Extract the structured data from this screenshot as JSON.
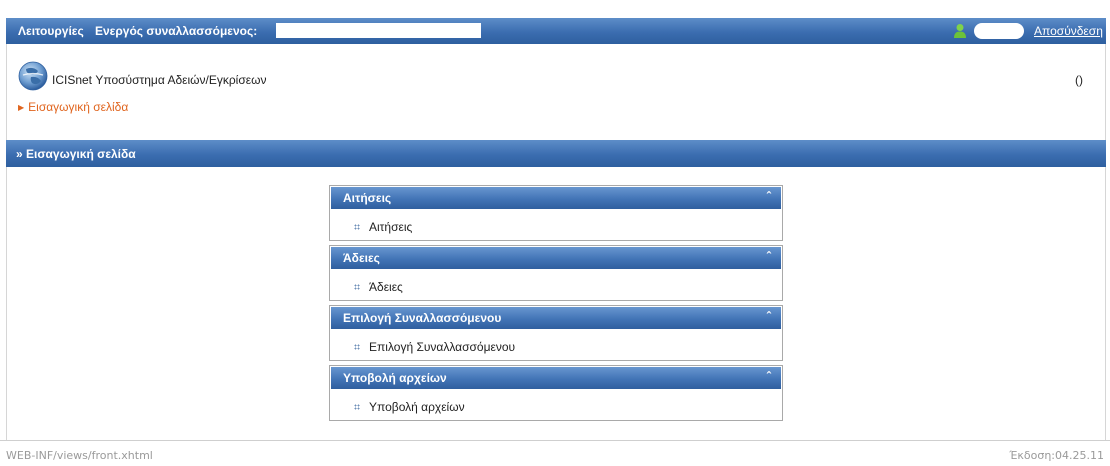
{
  "topbar": {
    "menu_label": "Λειτουργίες",
    "active_transactor_label": "Ενεργός συναλλασσόμενος:",
    "logout_label": "Αποσύνδεση"
  },
  "header": {
    "app_title": "ICISnet Υποσύστημα Αδειών/Εγκρίσεων",
    "breadcrumb": "Εισαγωγική σελίδα",
    "right_value": "()"
  },
  "section": {
    "title": "» Εισαγωγική σελίδα"
  },
  "panels": [
    {
      "title": "Αιτήσεις",
      "item": "Αιτήσεις"
    },
    {
      "title": "Άδειες",
      "item": "Άδειες"
    },
    {
      "title": "Επιλογή Συναλλασσόμενου",
      "item": "Επιλογή Συναλλασσόμενου"
    },
    {
      "title": "Υποβολή αρχείων",
      "item": "Υποβολή αρχείων"
    }
  ],
  "footer": {
    "path": "WEB-INF/views/front.xhtml",
    "version": "Έκδοση:04.25.11"
  },
  "colors": {
    "header_blue": "#3b6db0",
    "breadcrumb_orange": "#e0651f"
  },
  "icons": {
    "collapse": "double-chevron-up-icon",
    "user": "user-icon",
    "logo": "globe-logo-icon"
  }
}
